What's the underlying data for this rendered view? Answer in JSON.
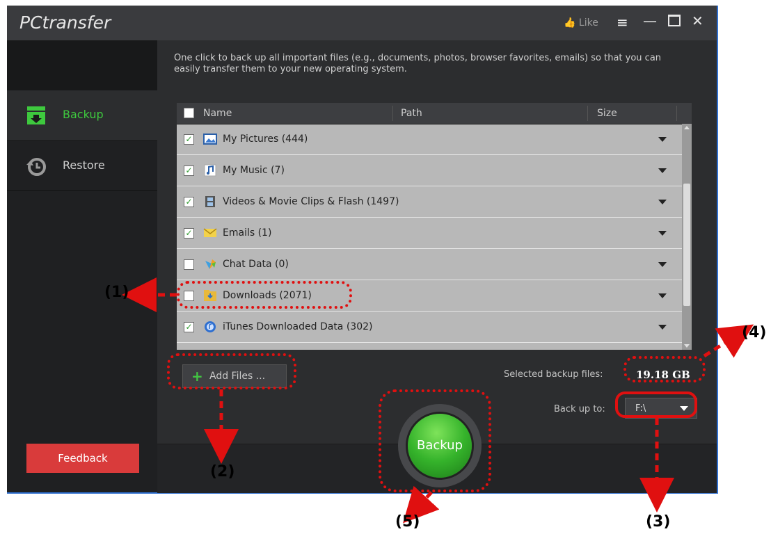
{
  "window": {
    "title": "PCtransfer",
    "like_label": "Like",
    "controls": [
      "menu",
      "minimize",
      "maximize",
      "close"
    ]
  },
  "sidebar": {
    "items": [
      {
        "label": "Backup",
        "icon": "backup-icon",
        "active": true,
        "color": "#3ec93e"
      },
      {
        "label": "Restore",
        "icon": "restore-icon",
        "active": false,
        "color": "#d0d0d0"
      }
    ],
    "feedback_label": "Feedback"
  },
  "main": {
    "description": "One click to back up all important files (e.g., documents, photos, browser favorites, emails) so that you can easily transfer them to your new operating system.",
    "table": {
      "columns": [
        "Name",
        "Path",
        "Size"
      ],
      "rows": [
        {
          "label": "My Pictures (444)",
          "checked": true,
          "icon": "pictures-icon"
        },
        {
          "label": "My Music (7)",
          "checked": true,
          "icon": "music-icon"
        },
        {
          "label": "Videos & Movie Clips & Flash (1497)",
          "checked": true,
          "icon": "video-icon"
        },
        {
          "label": "Emails (1)",
          "checked": true,
          "icon": "email-icon"
        },
        {
          "label": "Chat Data (0)",
          "checked": false,
          "icon": "chat-icon"
        },
        {
          "label": "Downloads (2071)",
          "checked": false,
          "icon": "downloads-folder-icon"
        },
        {
          "label": "iTunes Downloaded Data (302)",
          "checked": true,
          "icon": "itunes-icon"
        }
      ]
    },
    "add_files_label": "Add Files ...",
    "selected_label": "Selected backup files:",
    "selected_value": "19.18 GB",
    "backup_to_label": "Back up to:",
    "backup_to_value": "F:\\",
    "backup_button_label": "Backup"
  },
  "annotations": [
    "(1)",
    "(2)",
    "(3)",
    "(4)",
    "(5)"
  ],
  "colors": {
    "accent": "#3ec93e",
    "feedback": "#d93b3b",
    "annotation": "#e01010"
  }
}
